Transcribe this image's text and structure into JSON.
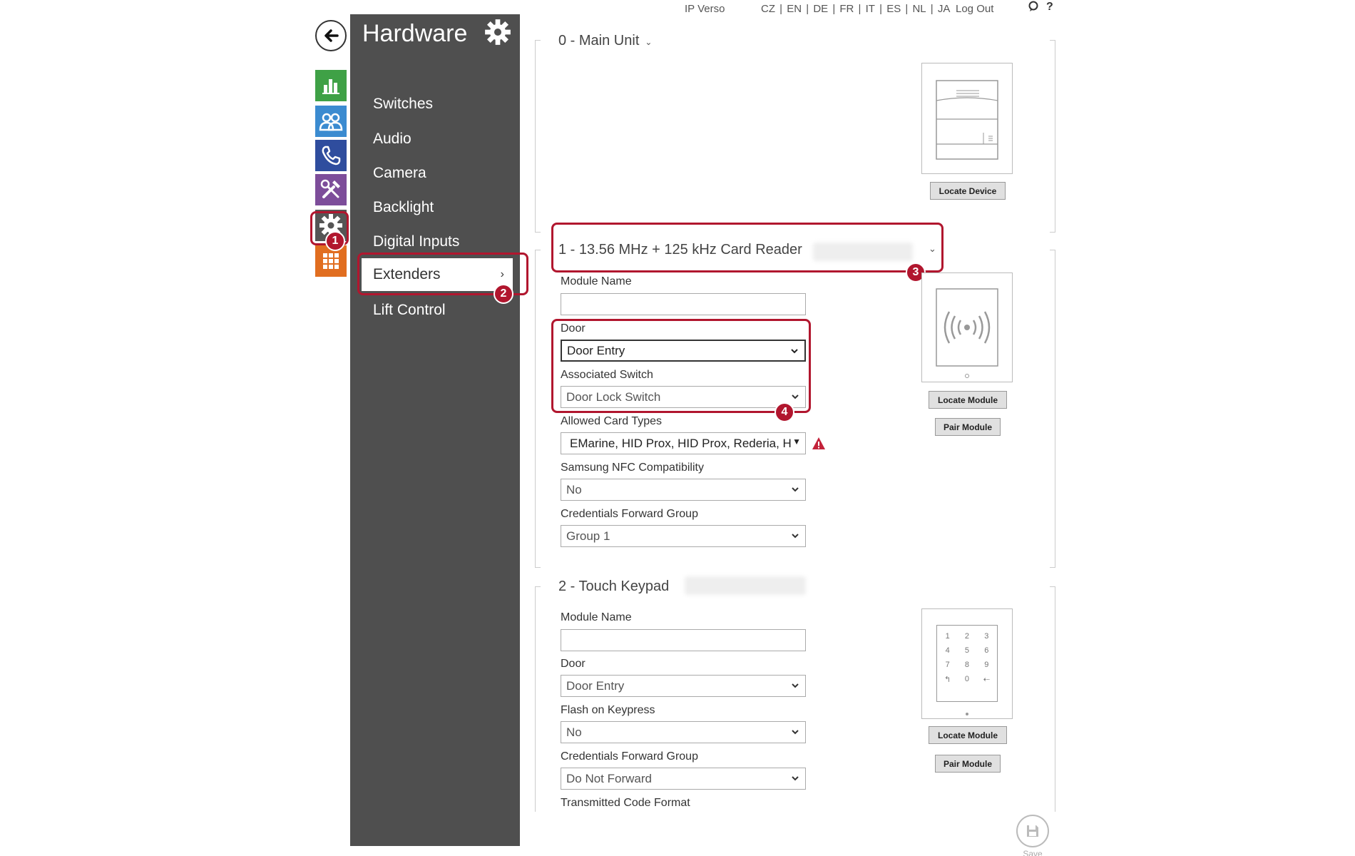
{
  "topbar": {
    "device_name": "IP Verso",
    "languages": [
      "CZ",
      "EN",
      "DE",
      "FR",
      "IT",
      "ES",
      "NL",
      "JA"
    ],
    "logout": "Log Out",
    "help_icon": "help-icon",
    "question": "?"
  },
  "rail": {
    "items": [
      {
        "icon": "status-chart-icon",
        "color": "#3fa146"
      },
      {
        "icon": "directory-users-icon",
        "color": "#3b8bd0"
      },
      {
        "icon": "calls-phone-icon",
        "color": "#2f4d9e"
      },
      {
        "icon": "services-tools-icon",
        "color": "#7d4d9a"
      },
      {
        "icon": "hardware-gear-icon",
        "color": "#555555"
      },
      {
        "icon": "system-grid-icon",
        "color": "#e16e20"
      }
    ]
  },
  "menu": {
    "title": "Hardware",
    "items": [
      "Switches",
      "Audio",
      "Camera",
      "Backlight",
      "Digital Inputs",
      "Extenders",
      "Lift Control"
    ],
    "active": "Extenders"
  },
  "badges": {
    "b1": "1",
    "b2": "2",
    "b3": "3",
    "b4": "4"
  },
  "sections": {
    "main_unit": {
      "title": "0 - Main Unit",
      "locate_button": "Locate Device"
    },
    "card_reader": {
      "title": "1 - 13.56 MHz + 125 kHz Card Reader",
      "module_name_label": "Module Name",
      "module_name_value": "",
      "door_label": "Door",
      "door_value": "Door Entry",
      "switch_label": "Associated Switch",
      "switch_value": "Door Lock Switch",
      "cards_label": "Allowed Card Types",
      "cards_value": "EMarine, HID Prox, HID Prox, Rederia, H",
      "nfc_label": "Samsung NFC Compatibility",
      "nfc_value": "No",
      "cred_label": "Credentials Forward Group",
      "cred_value": "Group 1",
      "locate_button": "Locate Module",
      "pair_button": "Pair Module"
    },
    "keypad": {
      "title": "2 - Touch Keypad",
      "module_name_label": "Module Name",
      "module_name_value": "",
      "door_label": "Door",
      "door_value": "Door Entry",
      "flash_label": "Flash on Keypress",
      "flash_value": "No",
      "cred_label": "Credentials Forward Group",
      "cred_value": "Do Not Forward",
      "format_label": "Transmitted Code Format",
      "keys": [
        "1",
        "2",
        "3",
        "4",
        "5",
        "6",
        "7",
        "8",
        "9",
        "↰",
        "0",
        "⇠"
      ],
      "locate_button": "Locate Module",
      "pair_button": "Pair Module"
    }
  },
  "save": {
    "label": "Save"
  }
}
